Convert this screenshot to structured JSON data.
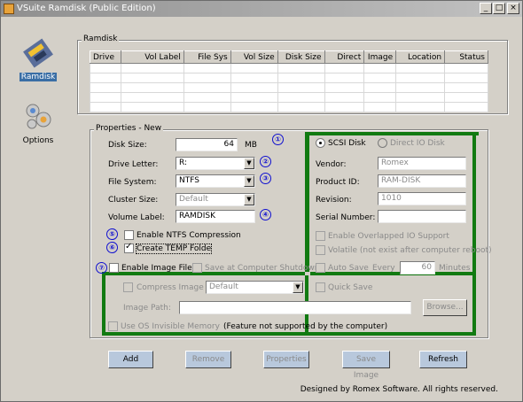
{
  "window": {
    "title": "VSuite Ramdisk (Public Edition)",
    "buttons": [
      "_",
      "□",
      "×"
    ]
  },
  "sidebar": {
    "items": [
      {
        "label": "Ramdisk",
        "icon": "ramdisk-icon"
      },
      {
        "label": "Options",
        "icon": "gears-icon"
      }
    ]
  },
  "ramdisk_group": {
    "title": "Ramdisk",
    "columns": [
      "Drive",
      "Vol Label",
      "File Sys",
      "Vol Size",
      "Disk Size",
      "Direct",
      "Image",
      "Location",
      "Status"
    ]
  },
  "properties": {
    "title": "Properties - New",
    "disk_size_label": "Disk Size:",
    "disk_size_value": "64",
    "disk_size_unit": "MB",
    "drive_letter_label": "Drive Letter:",
    "drive_letter_value": "R:",
    "file_system_label": "File System:",
    "file_system_value": "NTFS",
    "cluster_size_label": "Cluster Size:",
    "cluster_size_value": "Default",
    "volume_label_label": "Volume Label:",
    "volume_label_value": "RAMDISK",
    "ntfs_compression": "Enable NTFS Compression",
    "create_temp": "Create TEMP Folde",
    "enable_image": "Enable Image File",
    "save_at_shutdown": "Save at Computer Shutdown",
    "compress_image": "Compress Image",
    "compress_value": "Default",
    "image_path_label": "Image Path:",
    "browse": "Browse...",
    "use_os_invisible": "Use OS Invisible Memory",
    "os_invisible_note": "(Feature not supported by the computer)",
    "scsi_disk": "SCSI Disk",
    "direct_io_disk": "Direct IO Disk",
    "vendor_label": "Vendor:",
    "vendor_value": "Romex",
    "product_label": "Product ID:",
    "product_value": "RAM-DISK",
    "revision_label": "Revision:",
    "revision_value": "1010",
    "serial_label": "Serial Number:",
    "serial_value": "",
    "overlapped_io": "Enable Overlapped IO Support",
    "volatile": "Volatile (not exist after computer reboot)",
    "auto_save": "Auto Save",
    "every_label": "Every",
    "every_value": "60",
    "minutes_label": "Minutes",
    "quick_save": "Quick Save"
  },
  "markers": [
    "①",
    "②",
    "③",
    "④",
    "⑤",
    "⑥",
    "⑦"
  ],
  "buttons": {
    "add": "Add",
    "remove": "Remove",
    "properties": "Properties",
    "save_image": "Save Image",
    "refresh": "Refresh"
  },
  "footer": "Designed by Romex Software. All rights reserved.",
  "colors": {
    "highlight_border": "#117a11",
    "marker": "#1010d0"
  }
}
